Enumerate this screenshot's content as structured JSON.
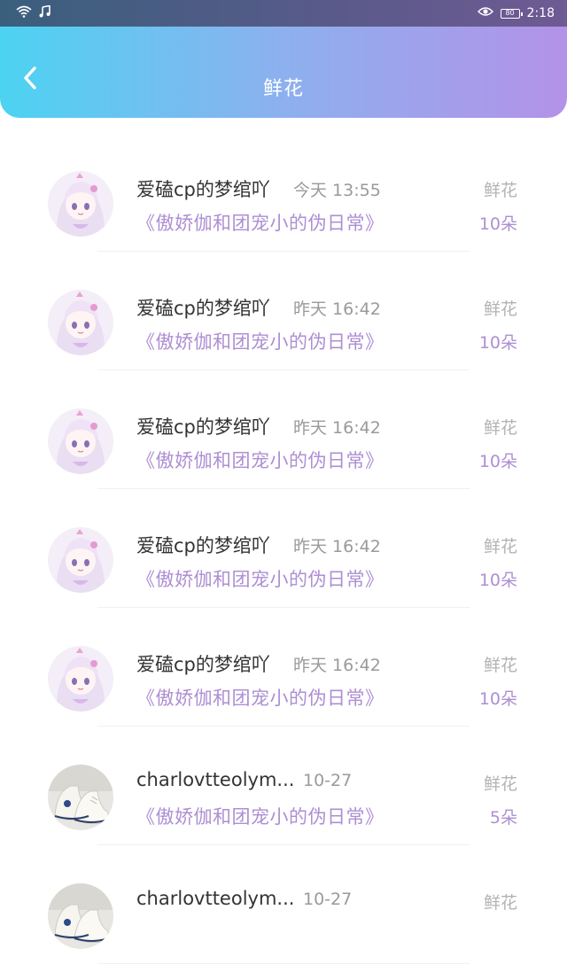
{
  "status_bar": {
    "time": "2:18",
    "battery": "80"
  },
  "header": {
    "title": "鲜花"
  },
  "colors": {
    "accent_purple": "#ae8fd3",
    "header_gradient_start": "#4cd3f2",
    "header_gradient_end": "#b392e8"
  },
  "rows": [
    {
      "avatar": "anime-girl-avatar",
      "name": "爱磕cp的梦绾吖",
      "time": "今天 13:55",
      "book": "《傲娇伽和团宠小的伪日常》",
      "gift": "鲜花",
      "count": "10朵"
    },
    {
      "avatar": "anime-girl-avatar",
      "name": "爱磕cp的梦绾吖",
      "time": "昨天 16:42",
      "book": "《傲娇伽和团宠小的伪日常》",
      "gift": "鲜花",
      "count": "10朵"
    },
    {
      "avatar": "anime-girl-avatar",
      "name": "爱磕cp的梦绾吖",
      "time": "昨天 16:42",
      "book": "《傲娇伽和团宠小的伪日常》",
      "gift": "鲜花",
      "count": "10朵"
    },
    {
      "avatar": "anime-girl-avatar",
      "name": "爱磕cp的梦绾吖",
      "time": "昨天 16:42",
      "book": "《傲娇伽和团宠小的伪日常》",
      "gift": "鲜花",
      "count": "10朵"
    },
    {
      "avatar": "anime-girl-avatar",
      "name": "爱磕cp的梦绾吖",
      "time": "昨天 16:42",
      "book": "《傲娇伽和团宠小的伪日常》",
      "gift": "鲜花",
      "count": "10朵"
    },
    {
      "avatar": "sneakers-avatar",
      "name": "charlovtteolym...",
      "time": "10-27",
      "book": "《傲娇伽和团宠小的伪日常》",
      "gift": "鲜花",
      "count": "5朵"
    },
    {
      "avatar": "sneakers-avatar",
      "name": "charlovtteolym...",
      "time": "10-27",
      "book": "",
      "gift": "鲜花",
      "count": ""
    }
  ]
}
